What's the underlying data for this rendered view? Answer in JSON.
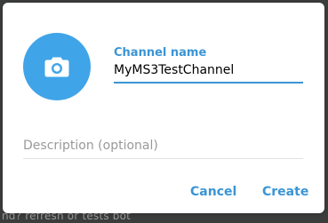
{
  "background": {
    "partial_text": "nd? refresh or tests bot"
  },
  "dialog": {
    "avatar": {
      "icon": "camera-icon",
      "color": "#3fa4e8"
    },
    "channel_name": {
      "label": "Channel name",
      "value": "MyMS3TestChannel"
    },
    "description": {
      "placeholder": "Description (optional)",
      "value": ""
    },
    "buttons": {
      "cancel_label": "Cancel",
      "create_label": "Create"
    },
    "accent_color": "#3a95d5"
  }
}
